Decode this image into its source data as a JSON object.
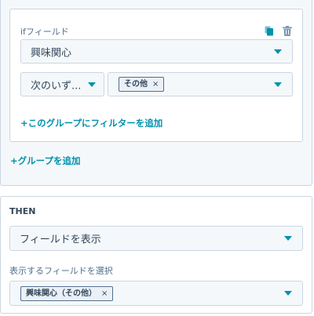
{
  "if_group": {
    "field_label": "ifフィールド",
    "field_select": {
      "value": "興味関心"
    },
    "operator_select": {
      "value": "次のいず..."
    },
    "values_select": {
      "tags": [
        {
          "label": "その他",
          "remove": "×"
        }
      ]
    },
    "add_filter_link": "+このグループにフィルターを追加"
  },
  "add_group_link": "+グループを追加",
  "then_section": {
    "title": "THEN",
    "action_select": {
      "value": "フィールドを表示"
    },
    "fields_label": "表示するフィールドを選択",
    "fields_select": {
      "tags": [
        {
          "label": "興味関心（その他）",
          "remove": "×"
        }
      ]
    }
  },
  "icons": {
    "copy": "copy-icon",
    "trash": "trash-icon",
    "caret": "caret-down-icon"
  },
  "colors": {
    "accent": "#0091ae",
    "border": "#cbd6e2",
    "panel_bg": "#f5f8fa",
    "text": "#33475b"
  }
}
